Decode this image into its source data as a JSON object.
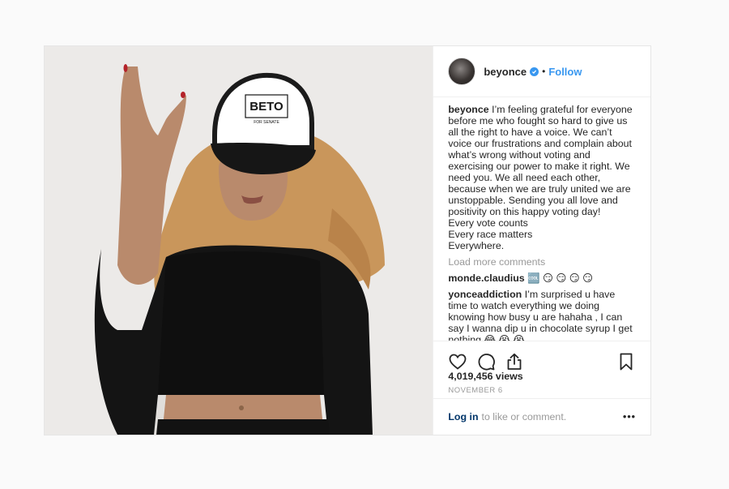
{
  "post": {
    "username": "beyonce",
    "follow_label": "Follow",
    "separator": "•",
    "photo": {
      "cap_text": "BETO",
      "cap_subtext": "FOR SENATE"
    },
    "caption": {
      "author": "beyonce",
      "text": "I’m feeling grateful for everyone before me who fought so hard to give us all the right to have a voice. We can’t voice our frustrations and complain about what’s wrong without voting and exercising our power to make it right. We need you. We all need each other, because when we are truly united we are unstoppable. Sending you all love and positivity on this happy voting day!\nEvery vote counts\nEvery race matters\nEverywhere."
    },
    "load_more_label": "Load more comments",
    "comments": [
      {
        "author": "monde.claudius",
        "text": "🆒 😏 😏 😏 😏"
      },
      {
        "author": "yonceaddiction",
        "text": "I’m surprised u have time to watch everything we doing knowing how busy u are hahaha , I can say I wanna dip u in chocolate syrup I get nothing 😂 😭 😭"
      }
    ],
    "views": "4,019,456 views",
    "date": "NOVEMBER 6",
    "footer": {
      "login_label": "Log in",
      "login_suffix": "to like or comment.",
      "more_label": "•••"
    }
  },
  "colors": {
    "accent": "#3897f0",
    "text": "#262626",
    "muted": "#999999",
    "link": "#003569"
  }
}
